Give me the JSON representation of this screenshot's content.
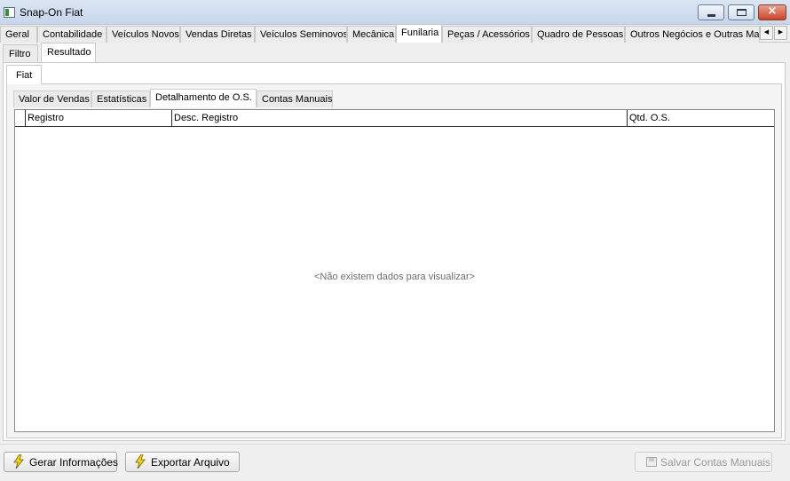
{
  "window": {
    "title": "Snap-On Fiat",
    "close_glyph": "×",
    "icons": [
      "app-icon",
      "minimize-icon",
      "maximize-icon",
      "close-icon"
    ]
  },
  "main_tabs": {
    "items": [
      "Geral",
      "Contabilidade",
      "Veículos Novos",
      "Vendas Diretas",
      "Veículos Seminovos",
      "Mecânica",
      "Funilaria",
      "Peças / Acessórios",
      "Quadro de Pessoas",
      "Outros Negócios e Outras Mar"
    ],
    "active": "Funilaria",
    "scroll_left": "◀",
    "scroll_right": "▶"
  },
  "view_tabs": {
    "items": [
      "Filtro",
      "Resultado"
    ],
    "active": "Resultado"
  },
  "brand_tab": "Fiat",
  "detail_tabs": {
    "items": [
      "Valor de Vendas",
      "Estatísticas",
      "Detalhamento de O.S.",
      "Contas Manuais"
    ],
    "active": "Detalhamento de O.S."
  },
  "grid": {
    "columns": [
      "Registro",
      "Desc. Registro",
      "Qtd. O.S."
    ],
    "empty_message": "<Não existem dados para visualizar>"
  },
  "footer": {
    "generate_label": "Gerar Informações",
    "export_label": "Exportar Arquivo",
    "save_label": "Salvar Contas Manuais",
    "icons": [
      "lightning-icon",
      "lightning-icon",
      "save-disk-icon"
    ]
  },
  "colors": {
    "titlebar": "#c7d6ea",
    "close_button": "#c9452c",
    "lightning": "#f5d61a",
    "empty_text": "#6d6d6d"
  }
}
